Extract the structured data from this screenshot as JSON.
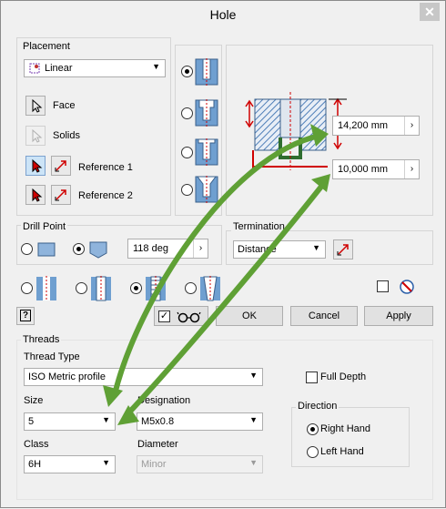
{
  "window": {
    "title": "Hole",
    "close_glyph": "✕"
  },
  "placement": {
    "group_label": "Placement",
    "type_value": "Linear",
    "face_label": "Face",
    "solids_label": "Solids",
    "reference1_label": "Reference 1",
    "reference2_label": "Reference 2"
  },
  "preview": {
    "depth_value": "14,200 mm",
    "diameter_value": "10,000 mm"
  },
  "drill_point": {
    "group_label": "Drill Point",
    "angle_value": "118 deg"
  },
  "termination": {
    "group_label": "Termination",
    "value": "Distance"
  },
  "buttons": {
    "help_glyph": "?",
    "ok": "OK",
    "cancel": "Cancel",
    "apply": "Apply"
  },
  "threads": {
    "group_label": "Threads",
    "thread_type_label": "Thread Type",
    "thread_type_value": "ISO Metric profile",
    "full_depth_label": "Full Depth",
    "size_label": "Size",
    "size_value": "5",
    "designation_label": "Designation",
    "designation_value": "M5x0.8",
    "class_label": "Class",
    "class_value": "6H",
    "diameter_label": "Diameter",
    "diameter_value": "Minor",
    "direction_label": "Direction",
    "right_hand_label": "Right Hand",
    "left_hand_label": "Left Hand"
  },
  "colors": {
    "accent_green": "#5fa035",
    "dim_red": "#e00000",
    "hatch_blue": "#6f9fd0"
  }
}
